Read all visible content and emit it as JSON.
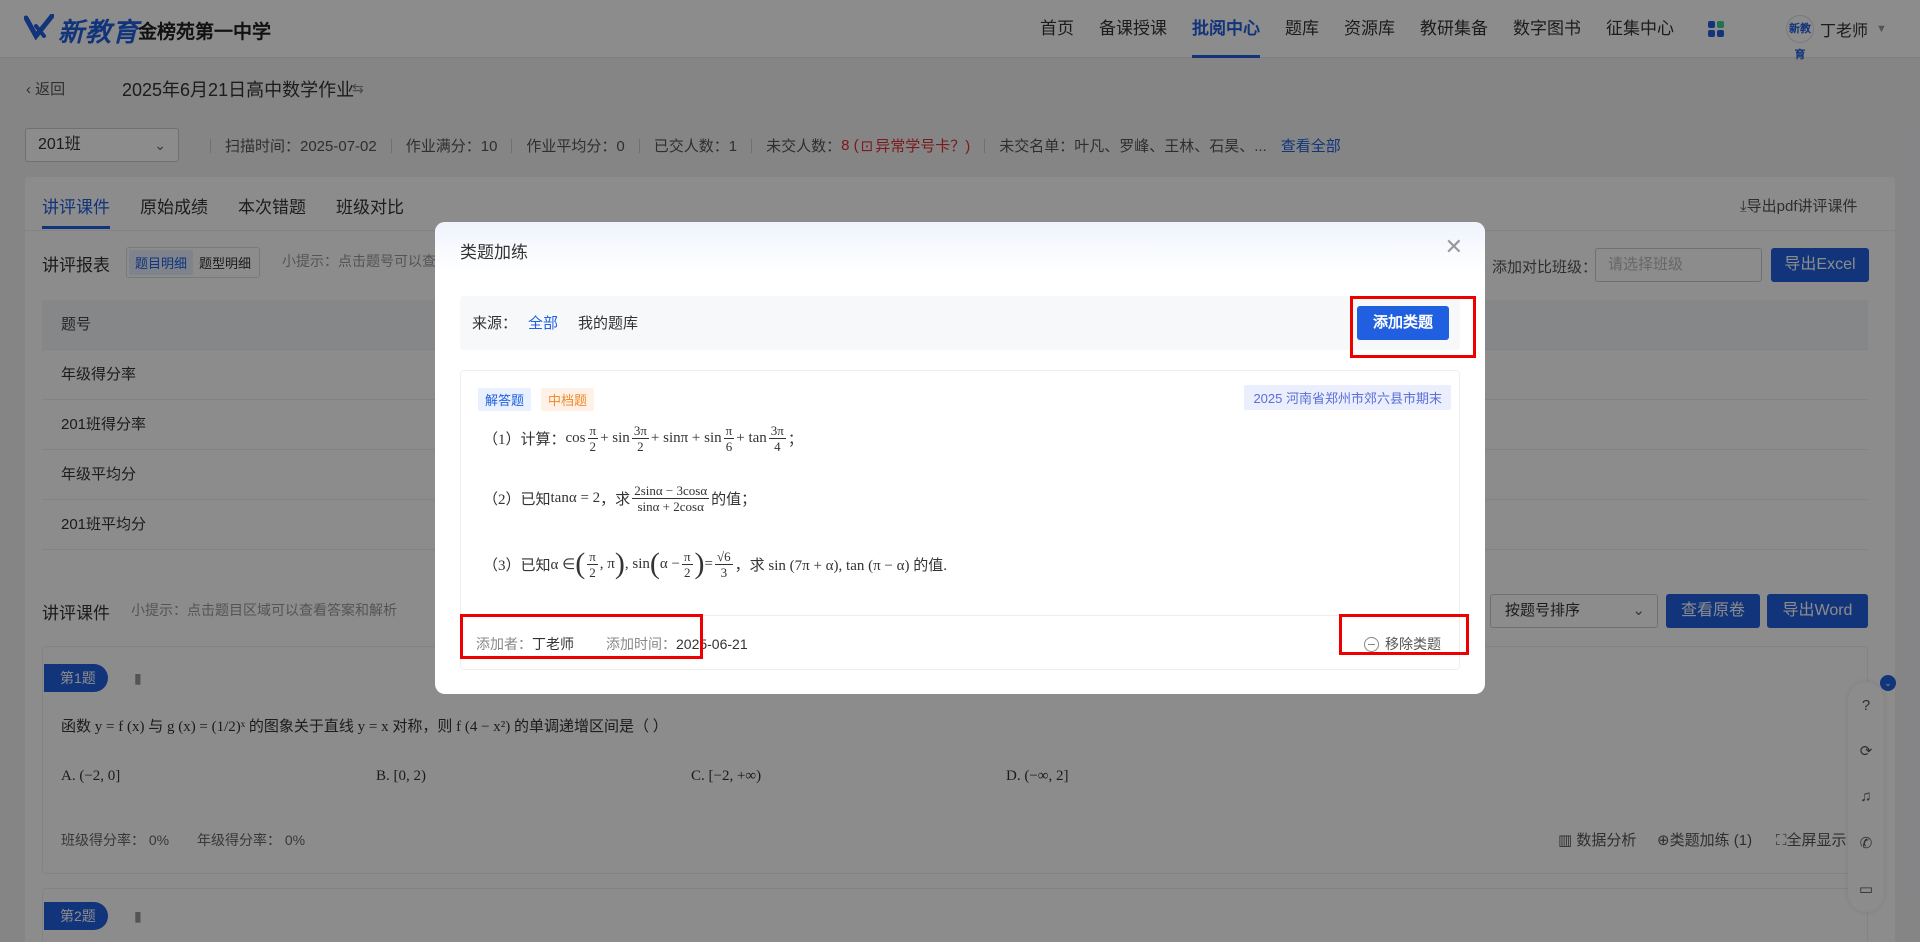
{
  "header": {
    "logo_text": "新教育",
    "school": "金榜苑第一中学",
    "nav": [
      "首页",
      "备课授课",
      "批阅中心",
      "题库",
      "资源库",
      "教研集备",
      "数字图书",
      "征集中心"
    ],
    "active_nav": "批阅中心",
    "avatar_text": "新教育",
    "user_name": "丁老师"
  },
  "title_row": {
    "back": "返回",
    "title": "2025年6月21日高中数学作业"
  },
  "info": {
    "class": "201班",
    "scan_time": "扫描时间：2025-07-02",
    "full_score": "作业满分：10",
    "avg_score": "作业平均分：0",
    "submitted": "已交人数：1",
    "not_submitted_label": "未交人数：",
    "not_submitted_value": "8 (",
    "abnormal": "异常学号卡？)",
    "missing_list": "未交名单：叶凡、罗峰、王林、石昊、...",
    "view_all": "查看全部"
  },
  "tabs": [
    "讲评课件",
    "原始成绩",
    "本次错题",
    "班级对比"
  ],
  "export_pdf": "导出pdf讲评课件",
  "report": {
    "label": "讲评报表",
    "seg_on": "题目明细",
    "seg_off": "题型明细",
    "hint": "小提示：点击题号可以查",
    "compare_label": "添加对比班级：",
    "compare_placeholder": "请选择班级",
    "export_excel": "导出Excel",
    "rows": [
      "题号",
      "年级得分率",
      "201班得分率",
      "年级平均分",
      "201班平均分"
    ]
  },
  "lecture": {
    "label": "讲评课件",
    "hint": "小提示：点击题目区域可以查看答案和解析",
    "sort": "按题号排序",
    "view_paper": "查看原卷",
    "export_word": "导出Word"
  },
  "question1": {
    "badge": "第1题",
    "text": "函数 y = f (x) 与 g (x) = (1/2)ˣ 的图象关于直线 y = x 对称，则 f (4 − x²) 的单调递增区间是（   ）",
    "options": [
      "A. (−2, 0]",
      "B. [0, 2)",
      "C. [−2, +∞)",
      "D. (−∞, 2]"
    ],
    "class_rate": "班级得分率： 0%",
    "grade_rate": "年级得分率： 0%",
    "tool_analysis": "数据分析",
    "tool_practice": "类题加练 (1)",
    "tool_fullscreen": "全屏显示"
  },
  "question2": {
    "badge": "第2题"
  },
  "modal": {
    "title": "类题加练",
    "source_label": "来源：",
    "source_all": "全部",
    "source_mine": "我的题库",
    "add_button": "添加类题",
    "tag_type": "解答题",
    "tag_level": "中档题",
    "origin": "2025 河南省郑州市郊六县市期末",
    "q1_prefix": "（1）计算：",
    "q2_prefix": "（2）已知",
    "q2_given": "tanα = 2",
    "q2_mid": "，求",
    "q2_num": "2sinα − 3cosα",
    "q2_den": "sinα + 2cosα",
    "q2_suffix": "的值；",
    "q3_prefix": "（3）已知",
    "q3_suffix": "，求 sin (7π + α), tan (π − α) 的值.",
    "added_by_label": "添加者：",
    "added_by": "丁老师",
    "added_time_label": "添加时间：",
    "added_time": "2025-06-21",
    "remove": "移除类题"
  },
  "colors": {
    "primary": "#1f5fe0",
    "danger": "#e03030",
    "highlight_box": "#e00000"
  }
}
